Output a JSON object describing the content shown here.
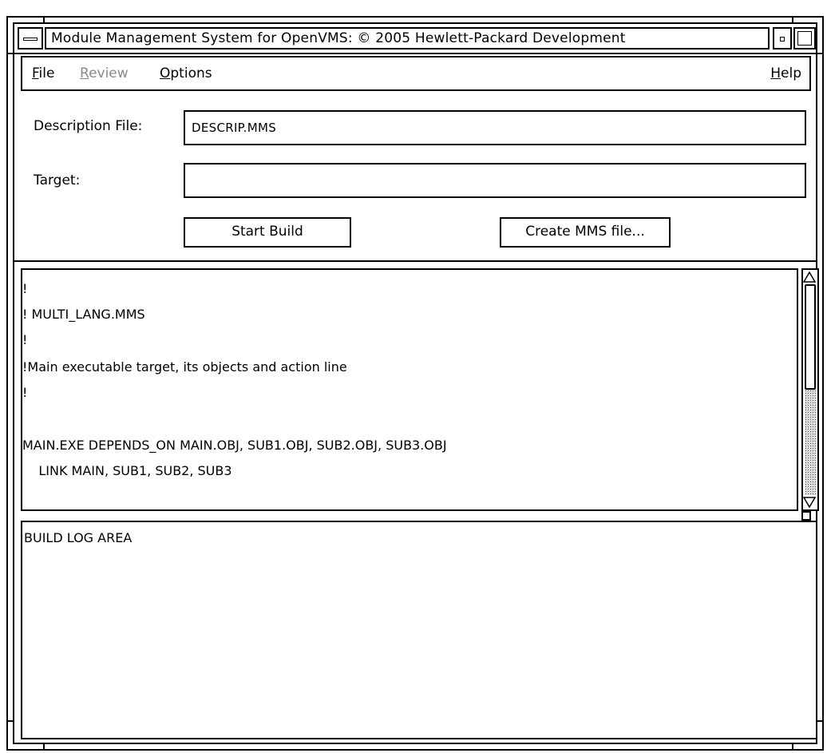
{
  "window": {
    "title": "Module Management System for OpenVMS: © 2005 Hewlett-Packard Development"
  },
  "menubar": {
    "items": [
      {
        "mnemonic": "F",
        "rest": "ile",
        "enabled": true
      },
      {
        "mnemonic": "R",
        "rest": "eview",
        "enabled": false
      },
      {
        "mnemonic": "O",
        "rest": "ptions",
        "enabled": true
      }
    ],
    "help": {
      "mnemonic": "H",
      "rest": "elp"
    }
  },
  "form": {
    "description_label": "Description File:",
    "description_value": "DESCRIP.MMS",
    "target_label": "Target:",
    "target_value": "",
    "start_build_label": "Start Build",
    "create_mms_label": "Create MMS file..."
  },
  "editor": {
    "lines": [
      "!",
      "! MULTI_LANG.MMS",
      "!",
      "!Main executable target, its objects and action line",
      "!",
      "",
      "MAIN.EXE DEPENDS_ON MAIN.OBJ, SUB1.OBJ, SUB2.OBJ, SUB3.OBJ",
      "    LINK MAIN, SUB1, SUB2, SUB3"
    ]
  },
  "build_log": {
    "text": "BUILD LOG AREA"
  },
  "icons": {
    "window_menu": "window-menu-icon",
    "minimize": "minimize-icon",
    "maximize": "maximize-icon",
    "scroll_up": "triangle-up-icon",
    "scroll_down": "triangle-down-icon"
  }
}
